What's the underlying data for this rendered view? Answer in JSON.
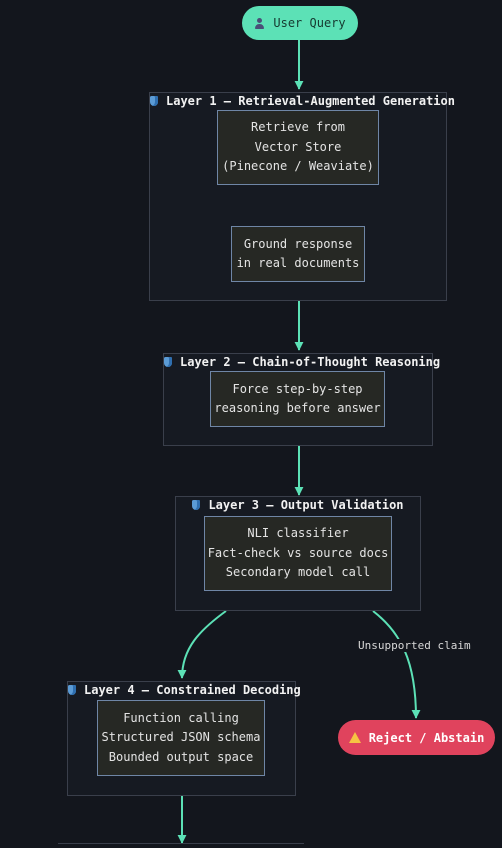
{
  "nodes": {
    "start": {
      "icon": "person-icon",
      "label": "User Query"
    },
    "reject": {
      "icon": "warning-icon",
      "label": "Reject / Abstain"
    }
  },
  "layers": [
    {
      "icon": "shield-icon",
      "title": "Layer 1 — Retrieval-Augmented Generation",
      "boxes": [
        [
          "Retrieve from",
          "Vector Store",
          "(Pinecone / Weaviate)"
        ],
        [
          "Ground response",
          "in real documents"
        ]
      ]
    },
    {
      "icon": "shield-icon",
      "title": "Layer 2 — Chain-of-Thought Reasoning",
      "boxes": [
        [
          "Force step-by-step",
          "reasoning before answer"
        ]
      ]
    },
    {
      "icon": "shield-icon",
      "title": "Layer 3 — Output Validation",
      "boxes": [
        [
          "NLI classifier",
          "Fact-check vs source docs",
          "Secondary model call"
        ]
      ]
    },
    {
      "icon": "shield-icon",
      "title": "Layer 4 — Constrained Decoding",
      "boxes": [
        [
          "Function calling",
          "Structured JSON schema",
          "Bounded output space"
        ]
      ]
    }
  ],
  "edges": {
    "unsupported_label": "Unsupported claim"
  },
  "colors": {
    "background": "#13161d",
    "edge": "#5ce1b6",
    "start": "#5ce1b6",
    "reject": "#e0435d",
    "box_border": "#6f86a6",
    "layer_border": "#3a3f4b"
  }
}
